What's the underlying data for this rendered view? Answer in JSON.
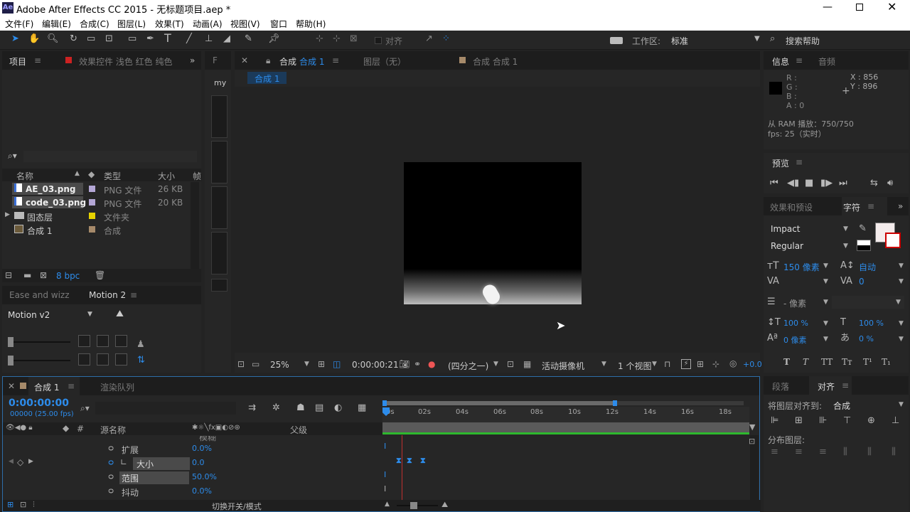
{
  "app_title": "Adobe After Effects CC 2015 - 无标题项目.aep *",
  "app_icon_text": "Ae",
  "menu": [
    "文件(F)",
    "编辑(E)",
    "合成(C)",
    "图层(L)",
    "效果(T)",
    "动画(A)",
    "视图(V)",
    "窗口",
    "帮助(H)"
  ],
  "toolbar": {
    "snap_label": "对齐",
    "workspace_label": "工作区:",
    "workspace_value": "标准",
    "search_placeholder": "搜索帮助"
  },
  "project": {
    "tab": "项目",
    "effects_tab": "效果控件 浅色 红色 纯色",
    "search_icon": "⌕▾",
    "columns": [
      "名称",
      "类型",
      "大小",
      "帧"
    ],
    "items": [
      {
        "name": "AE_03.png",
        "type": "PNG 文件",
        "size": "26 KB",
        "color": "#b4a7d6"
      },
      {
        "name": "code_03.png",
        "type": "PNG 文件",
        "size": "20 KB",
        "color": "#b4a7d6"
      },
      {
        "name": "固态层",
        "type": "文件夹",
        "size": "",
        "color": "#e6d200"
      },
      {
        "name": "合成 1",
        "type": "合成",
        "size": "",
        "color": "#a68a6a"
      }
    ],
    "bpc": "8 bpc"
  },
  "motion": {
    "tab1": "Ease and wizz",
    "tab2": "Motion 2",
    "dropdown": "Motion v2"
  },
  "narrow": {
    "tab": "F",
    "label": "my"
  },
  "comp_viewer": {
    "tab_label": "合成",
    "tab_name": "合成 1",
    "layer_tab": "图层（无）",
    "flow_tab": "合成 合成 1",
    "breadcrumb": "合成 1",
    "zoom": "25%",
    "timecode": "0:00:00:21",
    "resolution": "(四分之一)",
    "camera": "活动摄像机",
    "views": "1 个视图",
    "exposure": "+0.0"
  },
  "info": {
    "tab": "信息",
    "audio_tab": "音频",
    "r": "R :",
    "g": "G :",
    "b": "B :",
    "a": "A : 0",
    "x": "X : 856",
    "y": "Y : 896",
    "ram": "从 RAM 播放：750/750",
    "fps": "fps: 25（实时）"
  },
  "preview": {
    "tab": "预览"
  },
  "character": {
    "effects_tab": "效果和预设",
    "tab": "字符",
    "font": "Impact",
    "style": "Regular",
    "size": "150 像素",
    "leading": "自动",
    "tracking": "0",
    "stroke": "- 像素",
    "vscale": "100 %",
    "hscale": "100 %",
    "baseline": "0 像素",
    "tsume": "0 %",
    "styles": [
      "T",
      "T",
      "TT",
      "Tт",
      "T¹",
      "T₁"
    ]
  },
  "align": {
    "para_tab": "段落",
    "tab": "对齐",
    "align_to_label": "将图层对齐到:",
    "align_to_value": "合成",
    "distribute_label": "分布图层:"
  },
  "timeline": {
    "tab": "合成 1",
    "render_tab": "渲染队列",
    "timecode": "0:00:00:00",
    "fps": "00000 (25.00 fps)",
    "columns": {
      "source": "源名称",
      "parent": "父级"
    },
    "ruler": [
      "0s",
      "02s",
      "04s",
      "06s",
      "08s",
      "10s",
      "12s",
      "14s",
      "16s",
      "18s"
    ],
    "partial": "模糊",
    "props": [
      {
        "name": "扩展",
        "value": "0.0%"
      },
      {
        "name": "大小",
        "value": "0.0"
      },
      {
        "name": "范围",
        "value": "50.0%"
      },
      {
        "name": "抖动",
        "value": "0.0%"
      }
    ],
    "toggle_label": "切换开关/模式"
  }
}
